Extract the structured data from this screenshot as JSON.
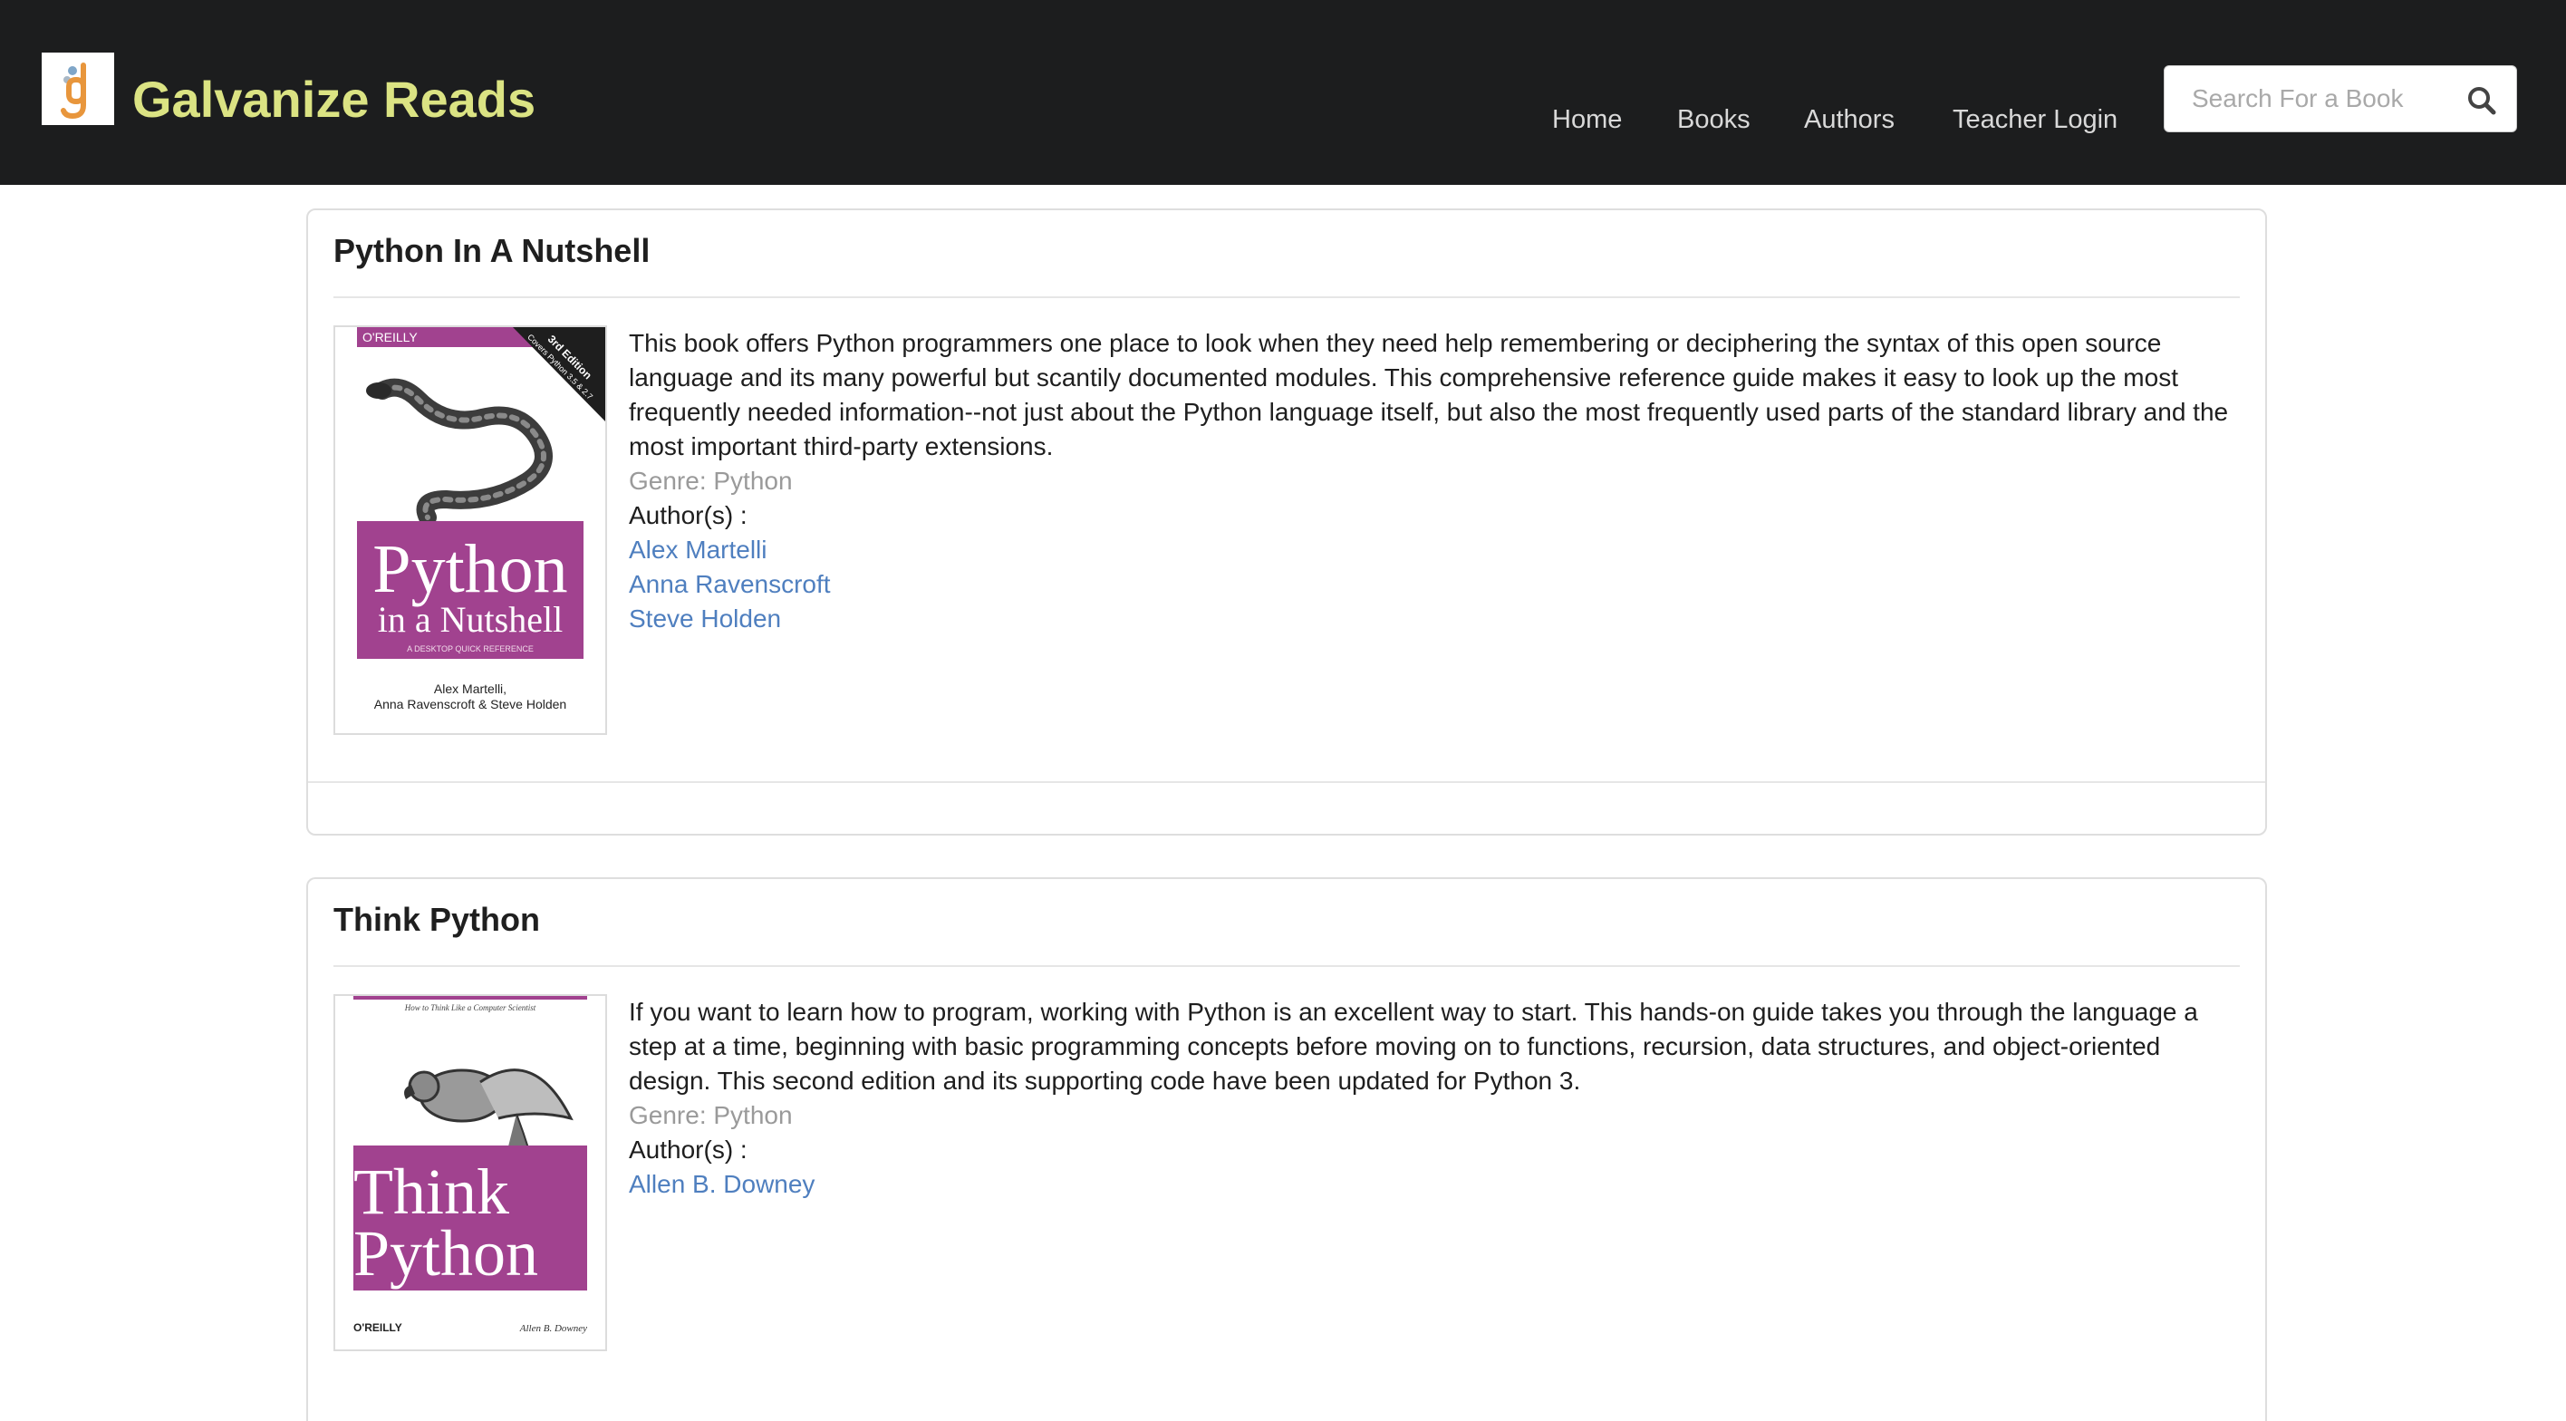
{
  "app": {
    "brand": "Galvanize Reads",
    "logo_icon": "galvanize-g-logo-icon",
    "brand_color": "#dbe383"
  },
  "nav": {
    "items": [
      {
        "label": "Home"
      },
      {
        "label": "Books"
      },
      {
        "label": "Authors"
      },
      {
        "label": "Teacher Login"
      }
    ]
  },
  "search": {
    "placeholder": "Search For a Book",
    "value": "",
    "icon": "search-icon"
  },
  "books": [
    {
      "title": "Python In A Nutshell",
      "description": "This book offers Python programmers one place to look when they need help remembering or deciphering the syntax of this open source language and its many powerful but scantily documented modules. This comprehensive reference guide makes it easy to look up the most frequently needed information--not just about the Python language itself, but also the most frequently used parts of the standard library and the most important third-party extensions.",
      "genre": "Genre: Python",
      "authors_label": "Author(s) :",
      "authors": [
        "Alex Martelli",
        "Anna Ravenscroft",
        "Steve Holden"
      ],
      "cover": {
        "publisher": "O'REILLY",
        "edition": "3rd Edition",
        "edition_sub": "Covers Python 3.5 & 2.7",
        "title_line1": "Python",
        "title_line2": "in a Nutshell",
        "subtitle": "A DESKTOP QUICK REFERENCE",
        "author_line1": "Alex Martelli,",
        "author_line2": "Anna Ravenscroft & Steve Holden",
        "accent": "#a1428f"
      }
    },
    {
      "title": "Think Python",
      "description": "If you want to learn how to program, working with Python is an excellent way to start. This hands-on guide takes you through the language a step at a time, beginning with basic programming concepts before moving on to functions, recursion, data structures, and object-oriented design. This second edition and its supporting code have been updated for Python 3.",
      "genre": "Genre: Python",
      "authors_label": "Author(s) :",
      "authors": [
        "Allen B. Downey"
      ],
      "cover": {
        "tagline": "How to Think Like a Computer Scientist",
        "title_line1": "Think",
        "title_line2": "Python",
        "publisher": "O'REILLY",
        "author": "Allen B. Downey",
        "accent": "#a1428f"
      }
    }
  ]
}
